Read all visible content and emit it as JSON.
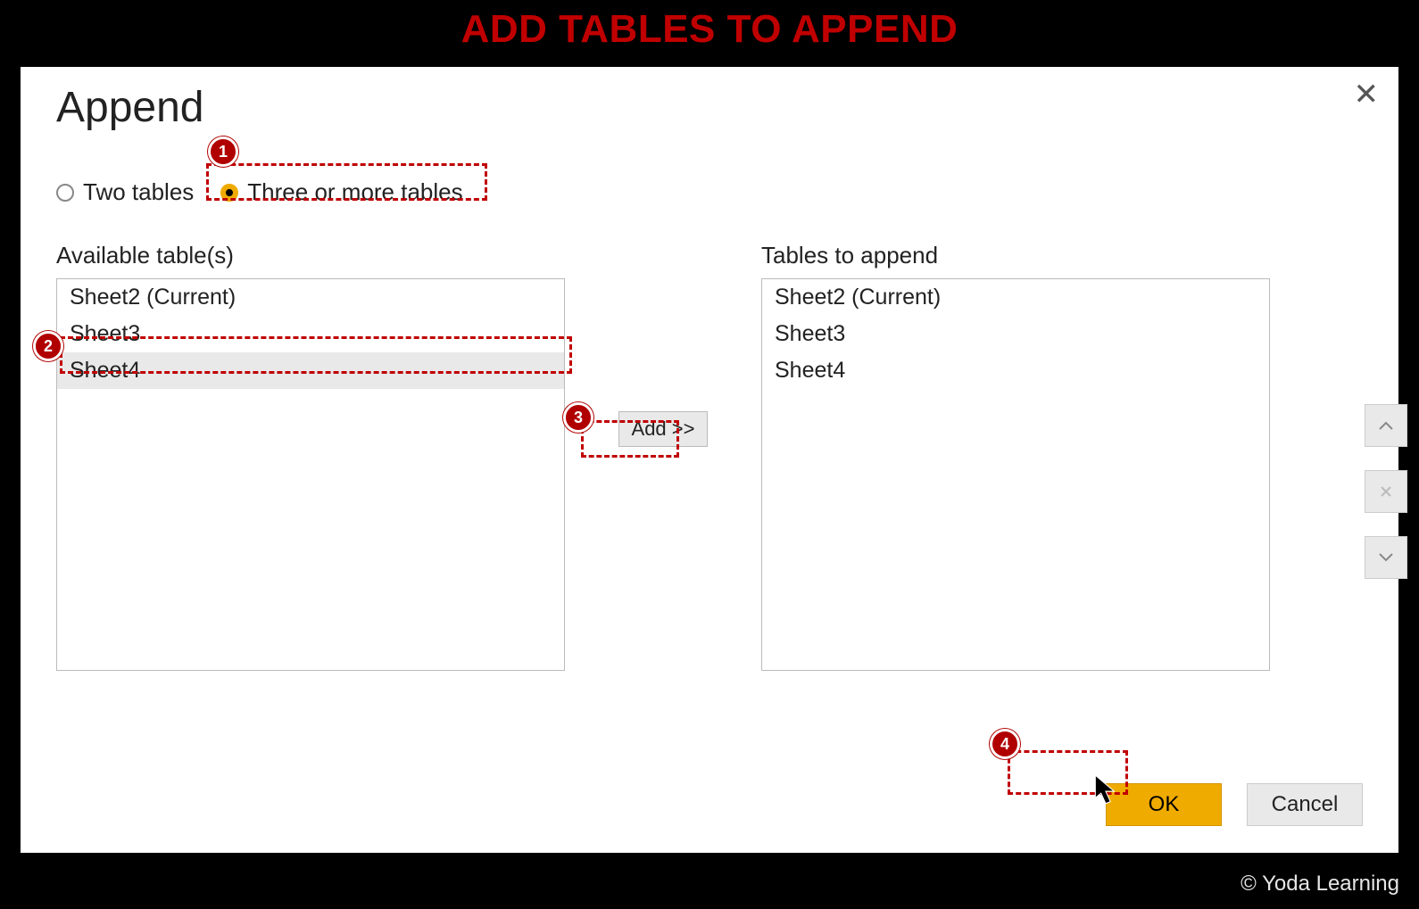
{
  "banner": "ADD TABLES TO APPEND",
  "dialog": {
    "title": "Append",
    "radio_two": "Two tables",
    "radio_three": "Three or more tables",
    "available_label": "Available table(s)",
    "append_label": "Tables to append",
    "available": [
      "Sheet2 (Current)",
      "Sheet3",
      "Sheet4"
    ],
    "append": [
      "Sheet2 (Current)",
      "Sheet3",
      "Sheet4"
    ],
    "selected_available_index": 2,
    "add_label": "Add >>",
    "ok_label": "OK",
    "cancel_label": "Cancel"
  },
  "callouts": {
    "c1": "1",
    "c2": "2",
    "c3": "3",
    "c4": "4"
  },
  "copyright": "© Yoda Learning"
}
